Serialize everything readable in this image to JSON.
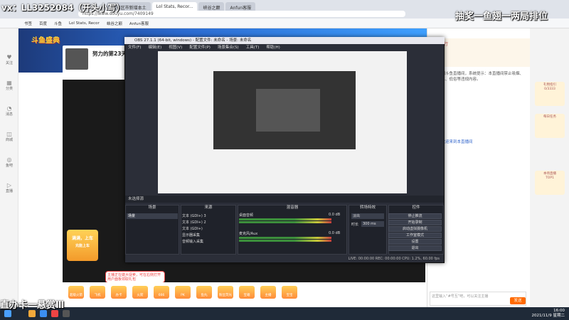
{
  "watermarks": {
    "top_left": "vx：LL3252084（开头小写）",
    "top_right": "抽奖一鱼翅一两局排位",
    "bottom_left": "直办卡一悬赏Ⅲ"
  },
  "browser": {
    "url": "https://www.douyu.com/7409149",
    "tabs": [
      {
        "label": "31省区市新增本土"
      },
      {
        "label": "Lol Stats, Recor..."
      },
      {
        "label": "峡谷之巅"
      },
      {
        "label": "Anfun客服"
      }
    ],
    "bookmarks": [
      "书签",
      "百度",
      "斗鱼",
      "Lol Stats, Recor",
      "峡谷之巅",
      "Anfun客服"
    ]
  },
  "left_nav": [
    {
      "label": "关注",
      "icon": "heart-icon"
    },
    {
      "label": "分类",
      "icon": "grid-icon"
    },
    {
      "label": "消息",
      "icon": "bell-icon"
    },
    {
      "label": "游戏",
      "icon": "gamepad-icon"
    },
    {
      "label": "分享",
      "icon": "share-icon"
    },
    {
      "label": "商城",
      "icon": "cart-icon"
    },
    {
      "label": "鱼吧",
      "icon": "fish-icon"
    },
    {
      "label": "直播",
      "icon": "live-icon"
    },
    {
      "label": "客服",
      "icon": "service-icon"
    }
  ],
  "room": {
    "banner_logo": "斗鱼盛典",
    "anchor_name": "努力的第23天",
    "anchor_level": "V"
  },
  "obs": {
    "title": "OBS 27.1.1 (64-bit, windows) - 配置文件: 未命名 - 场景: 未命名",
    "menu": [
      "文件(F)",
      "编辑(E)",
      "视图(V)",
      "配置文件(P)",
      "场景集合(S)",
      "工具(T)",
      "帮助(H)"
    ],
    "status": "未选择源",
    "docks": {
      "scenes": "场景",
      "sources": "来源",
      "mixer": "混音器",
      "transitions": "转场特效",
      "controls": "控件"
    },
    "scene_list": [
      "场景"
    ],
    "sources": [
      "文本 (GDI+) 3",
      "文本 (GDI+) 2",
      "文本 (GDI+)",
      "显示器采集",
      "音频输入采集"
    ],
    "mixer": [
      {
        "label": "桌面音频",
        "level": "0.0 dB"
      },
      {
        "label": "麦克风/Aux",
        "level": "0.0 dB"
      }
    ],
    "transition": {
      "type": "淡出",
      "duration_label": "时长",
      "duration": "300 ms"
    },
    "controls": [
      "停止推流",
      "开始录制",
      "启动虚拟摄像机",
      "工作室模式",
      "设置",
      "退出"
    ],
    "bottom_status": "LIVE: 00:00:00   REC: 00:00:00   CPU: 1.2%, 60.00 fps"
  },
  "promo": {
    "text": "满满，上车",
    "sub": "充能上车"
  },
  "popup": {
    "text": "主播正在做大促卖，可在右侧打开用户面板领取礼包"
  },
  "gifts": [
    "超级火箭",
    "飞机",
    "办卡",
    "火箭",
    "666",
    "PK",
    "鱼丸",
    "粉丝荧光棒",
    "宝箱",
    "主播",
    "宝宝"
  ],
  "right_panel": {
    "header": "主播排行",
    "tabs": [
      "贵宾",
      "粉丝团"
    ],
    "notice": "欢迎来到斗鱼直播间，系统提示：本直播间禁止吸烟、未成年人、低俗等违规内容。",
    "chat_line": "风云：欢迎来到本直播间",
    "placeholder": "这里输入“#号互”吧，可以关注主播",
    "send": "发送",
    "rank": "1"
  },
  "far_right": [
    {
      "label": "礼物指引",
      "value": "0/3333"
    },
    {
      "label": "每日任务"
    },
    {
      "label": "本场直播",
      "value": "TOP1"
    }
  ],
  "taskbar": {
    "time": "16:00",
    "date": "2021/11/9 星期二"
  }
}
